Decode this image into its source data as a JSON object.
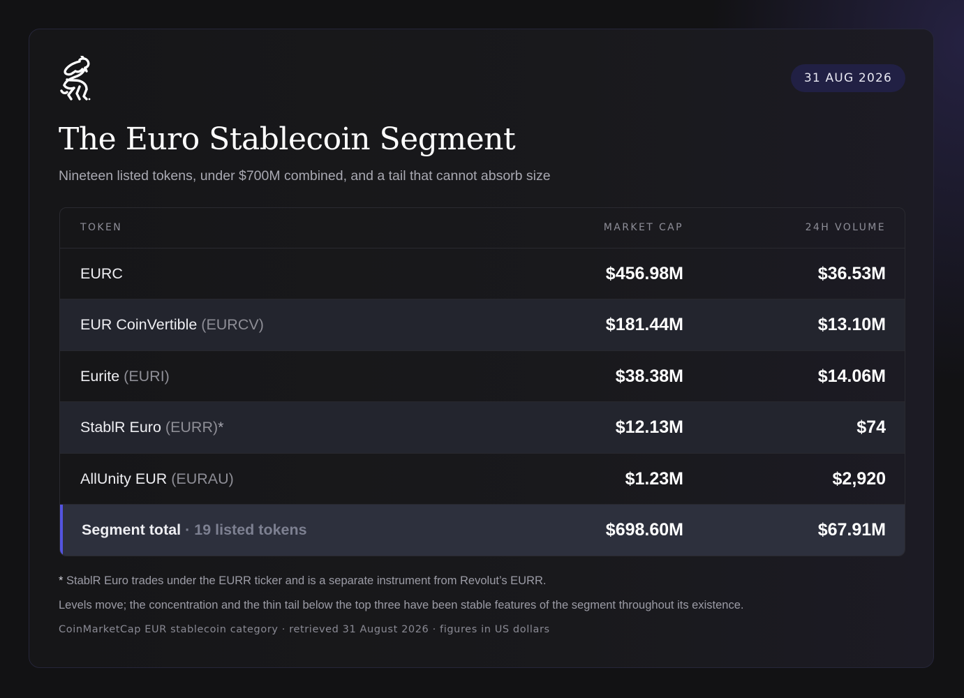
{
  "header": {
    "date": "31 AUG 2026",
    "title": "The Euro Stablecoin Segment",
    "subtitle": "Nineteen listed tokens, under $700M combined, and a tail that cannot absorb size"
  },
  "table": {
    "columns": [
      "TOKEN",
      "MARKET CAP",
      "24H VOLUME"
    ],
    "rows": [
      {
        "name": "EURC",
        "ticker": "",
        "marker": "",
        "market_cap": "$456.98M",
        "volume_24h": "$36.53M"
      },
      {
        "name": "EUR CoinVertible",
        "ticker": "(EURCV)",
        "marker": "",
        "market_cap": "$181.44M",
        "volume_24h": "$13.10M"
      },
      {
        "name": "Eurite",
        "ticker": "(EURI)",
        "marker": "",
        "market_cap": "$38.38M",
        "volume_24h": "$14.06M"
      },
      {
        "name": "StablR Euro",
        "ticker": "(EURR)",
        "marker": "*",
        "market_cap": "$12.13M",
        "volume_24h": "$74"
      },
      {
        "name": "AllUnity EUR",
        "ticker": "(EURAU)",
        "marker": "",
        "market_cap": "$1.23M",
        "volume_24h": "$2,920"
      }
    ],
    "total": {
      "label": "Segment total",
      "meta": "· 19 listed tokens",
      "market_cap": "$698.60M",
      "volume_24h": "$67.91M"
    }
  },
  "footnotes": {
    "star_mark": "*",
    "note_star": "StablR Euro trades under the EURR ticker and is a separate instrument from Revolut’s EURR.",
    "note_levels": "Levels move; the concentration and the thin tail below the top three have been stable features of the segment throughout its existence.",
    "source": "CoinMarketCap EUR stablecoin category · retrieved 31 August 2026 · figures in US dollars"
  },
  "colors": {
    "background": "#121214",
    "date_pill": "#212044",
    "alt_row": "#23252e",
    "total_row": "#2d303d",
    "total_accent": "#5454e0"
  },
  "icons": {
    "logo": "rearing-horse-logo"
  }
}
